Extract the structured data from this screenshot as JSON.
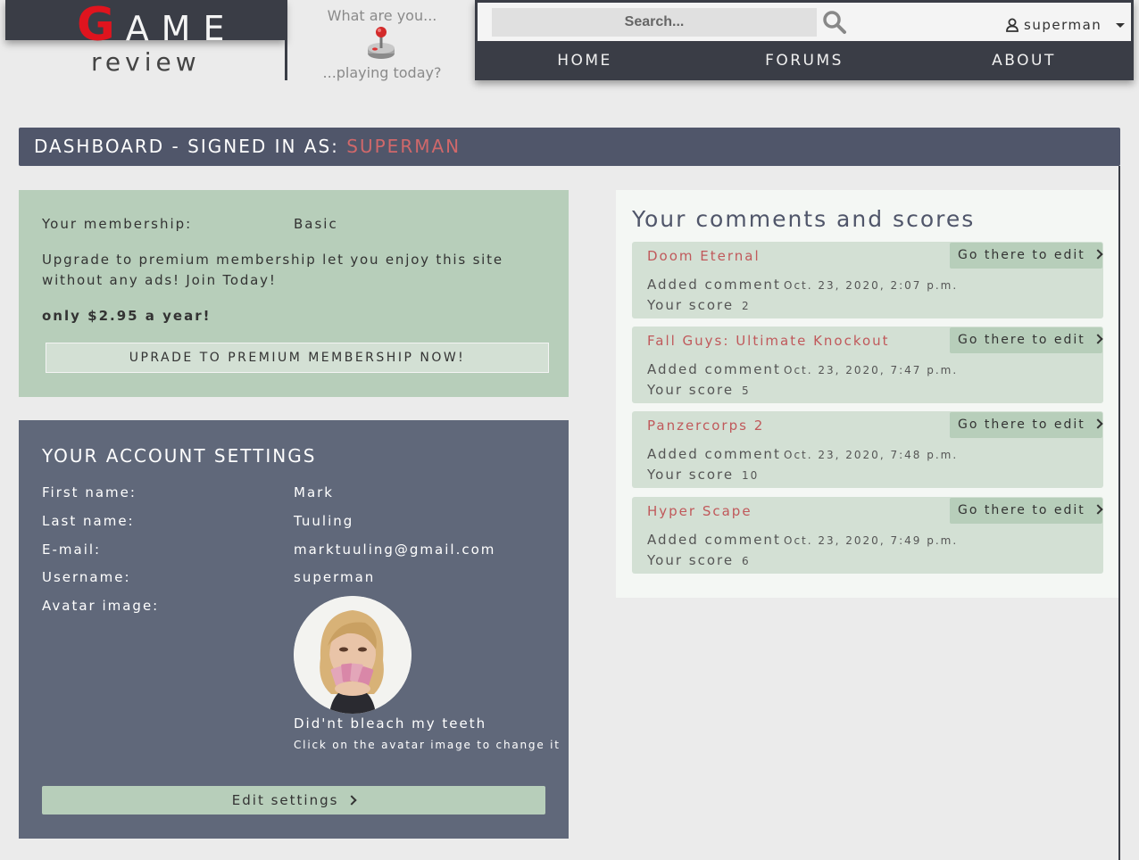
{
  "logo": {
    "g": "G",
    "ame": "AME",
    "review": "review"
  },
  "tagline": {
    "top": "What are you...",
    "bottom": "...playing today?"
  },
  "search": {
    "placeholder": "Search..."
  },
  "user_menu": {
    "username": "superman"
  },
  "nav": [
    {
      "label": "HOME"
    },
    {
      "label": "FORUMS"
    },
    {
      "label": "ABOUT"
    }
  ],
  "dashboard": {
    "title_prefix": "DASHBOARD - SIGNED IN AS: ",
    "username": "SUPERMAN"
  },
  "membership": {
    "label": "Your membership:",
    "value": "Basic",
    "description": "Upgrade to premium membership let you enjoy this site without any ads! Join Today!",
    "price": "only $2.95 a year!",
    "upgrade_button": "UPRADE TO PREMIUM MEMBERSHIP NOW!"
  },
  "account": {
    "title": "YOUR ACCOUNT SETTINGS",
    "rows": [
      {
        "label": "First name:",
        "value": "Mark"
      },
      {
        "label": "Last name:",
        "value": "Tuuling"
      },
      {
        "label": "E-mail:",
        "value": "marktuuling@gmail.com"
      },
      {
        "label": "Username:",
        "value": "superman"
      },
      {
        "label": "Avatar image:",
        "value": ""
      }
    ],
    "avatar_caption": "Did'nt bleach my teeth",
    "avatar_hint": "Click on the avatar image to change it",
    "edit_button": "Edit settings"
  },
  "comments": {
    "title": "Your comments and scores",
    "edit_label": "Go there to edit",
    "added_label": "Added comment",
    "score_label": "Your score",
    "items": [
      {
        "game": "Doom Eternal",
        "date": "Oct. 23, 2020, 2:07 p.m.",
        "score": "2"
      },
      {
        "game": "Fall Guys: Ultimate Knockout",
        "date": "Oct. 23, 2020, 7:47 p.m.",
        "score": "5"
      },
      {
        "game": "Panzercorps 2",
        "date": "Oct. 23, 2020, 7:48 p.m.",
        "score": "10"
      },
      {
        "game": "Hyper Scape",
        "date": "Oct. 23, 2020, 7:49 p.m.",
        "score": "6"
      }
    ]
  },
  "colors": {
    "dark": "#3a3d46",
    "accent_red": "#e0141e",
    "highlight": "#d0686a",
    "green_panel": "#b7ceba",
    "slate_panel": "#60687a"
  }
}
